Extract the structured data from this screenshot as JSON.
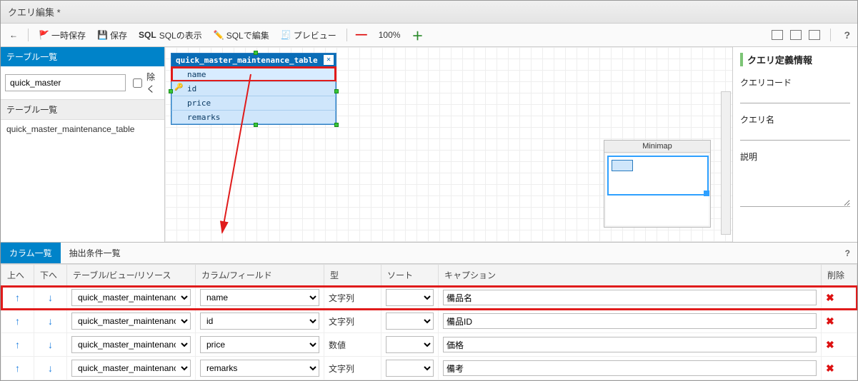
{
  "window": {
    "title": "クエリ編集 *"
  },
  "toolbar": {
    "temp_save": "一時保存",
    "save": "保存",
    "show_sql_prefix": "SQL",
    "show_sql": "SQLの表示",
    "edit_sql": "SQLで編集",
    "preview": "プレビュー",
    "zoom": "100%"
  },
  "left": {
    "header": "テーブル一覧",
    "filter_value": "quick_master",
    "exclude_label": "除く",
    "sub_header": "テーブル一覧",
    "items": [
      "quick_master_maintenance_table"
    ]
  },
  "entity": {
    "title": "quick_master_maintenance_table",
    "fields": [
      {
        "name": "name",
        "pk": false,
        "selected": true
      },
      {
        "name": "id",
        "pk": true,
        "selected": false
      },
      {
        "name": "price",
        "pk": false,
        "selected": false
      },
      {
        "name": "remarks",
        "pk": false,
        "selected": false
      }
    ]
  },
  "minimap": {
    "title": "Minimap"
  },
  "right": {
    "header": "クエリ定義情報",
    "code_label": "クエリコード",
    "code_value": "",
    "name_label": "クエリ名",
    "name_value": "",
    "desc_label": "説明",
    "desc_value": ""
  },
  "tabs": {
    "columns": "カラム一覧",
    "conditions": "抽出条件一覧"
  },
  "grid": {
    "headers": {
      "up": "上へ",
      "down": "下へ",
      "table": "テーブル/ビュー/リソース",
      "column": "カラム/フィールド",
      "type": "型",
      "sort": "ソート",
      "caption": "キャプション",
      "delete": "削除"
    },
    "table_name": "quick_master_maintenanc",
    "sort_options": [
      ""
    ],
    "rows": [
      {
        "column": "name",
        "type": "文字列",
        "sort": "",
        "caption": "備品名",
        "highlight": true
      },
      {
        "column": "id",
        "type": "文字列",
        "sort": "",
        "caption": "備品ID",
        "highlight": false
      },
      {
        "column": "price",
        "type": "数値",
        "sort": "",
        "caption": "価格",
        "highlight": false
      },
      {
        "column": "remarks",
        "type": "文字列",
        "sort": "",
        "caption": "備考",
        "highlight": false
      }
    ]
  }
}
